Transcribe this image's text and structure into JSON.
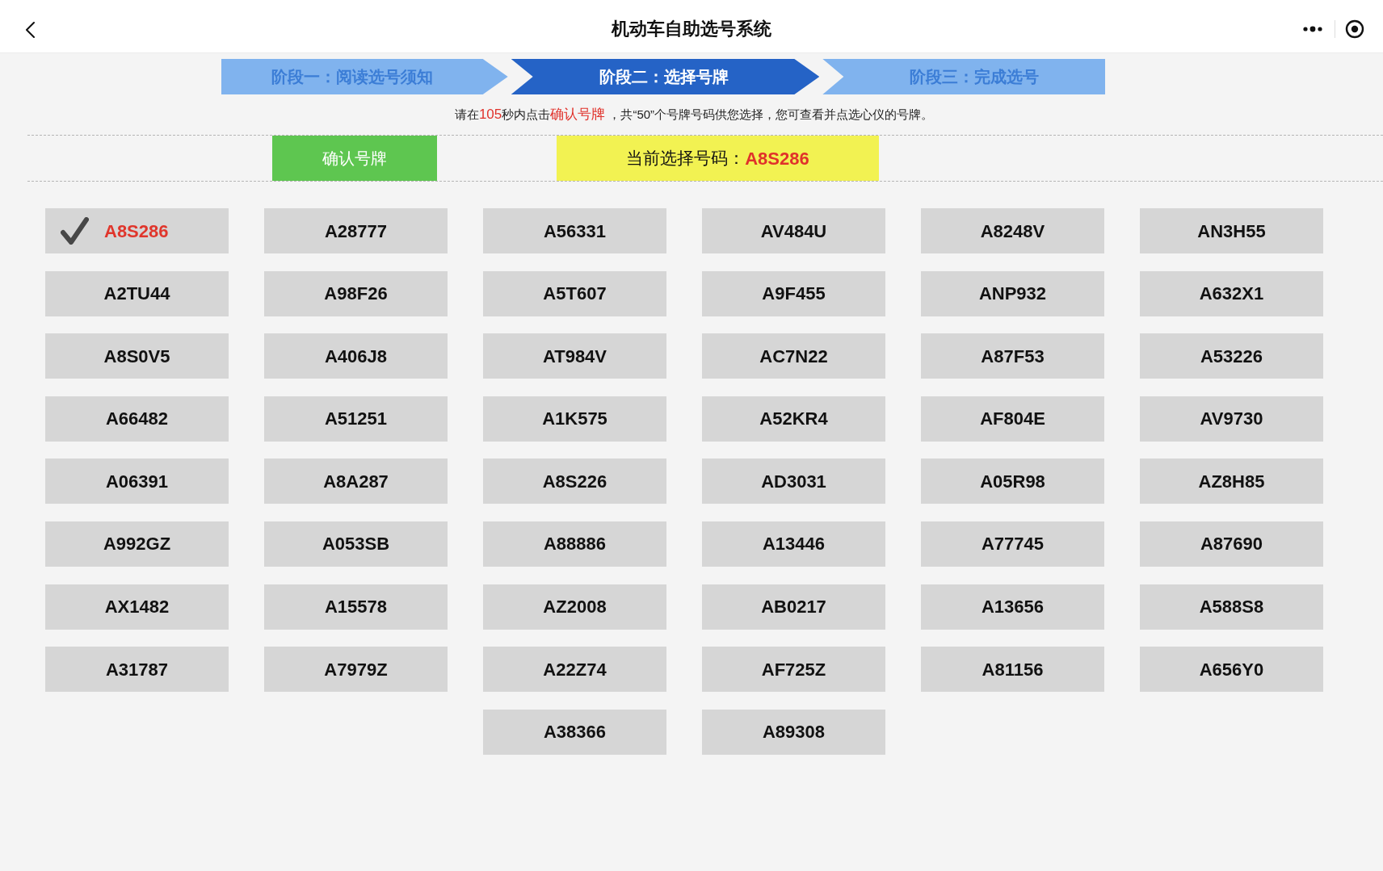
{
  "header": {
    "title": "机动车自助选号系统"
  },
  "steps": [
    {
      "label": "阶段一：阅读选号须知",
      "selected": false
    },
    {
      "label": "阶段二：选择号牌",
      "selected": true
    },
    {
      "label": "阶段三：完成选号",
      "selected": false
    }
  ],
  "notice": [
    {
      "text": "请在",
      "highlight": false
    },
    {
      "text": "105",
      "highlight": true
    },
    {
      "text": "秒内点击",
      "highlight": false
    },
    {
      "text": "确认号牌",
      "highlight": true
    },
    {
      "text": " ，共“50”个号牌号码供您选择，您可查看并点选心仪的号牌。",
      "highlight": false
    }
  ],
  "confirm_button": {
    "label": "确认号牌"
  },
  "current_selection": {
    "label": "当前选择号码：",
    "value": "A8S286"
  },
  "plates": [
    {
      "number": "A8S286",
      "selected": true
    },
    {
      "number": "A28777",
      "selected": false
    },
    {
      "number": "A56331",
      "selected": false
    },
    {
      "number": "AV484U",
      "selected": false
    },
    {
      "number": "A8248V",
      "selected": false
    },
    {
      "number": "AN3H55",
      "selected": false
    },
    {
      "number": "A2TU44",
      "selected": false
    },
    {
      "number": "A98F26",
      "selected": false
    },
    {
      "number": "A5T607",
      "selected": false
    },
    {
      "number": "A9F455",
      "selected": false
    },
    {
      "number": "ANP932",
      "selected": false
    },
    {
      "number": "A632X1",
      "selected": false
    },
    {
      "number": "A8S0V5",
      "selected": false
    },
    {
      "number": "A406J8",
      "selected": false
    },
    {
      "number": "AT984V",
      "selected": false
    },
    {
      "number": "AC7N22",
      "selected": false
    },
    {
      "number": "A87F53",
      "selected": false
    },
    {
      "number": "A53226",
      "selected": false
    },
    {
      "number": "A66482",
      "selected": false
    },
    {
      "number": "A51251",
      "selected": false
    },
    {
      "number": "A1K575",
      "selected": false
    },
    {
      "number": "A52KR4",
      "selected": false
    },
    {
      "number": "AF804E",
      "selected": false
    },
    {
      "number": "AV9730",
      "selected": false
    },
    {
      "number": "A06391",
      "selected": false
    },
    {
      "number": "A8A287",
      "selected": false
    },
    {
      "number": "A8S226",
      "selected": false
    },
    {
      "number": "AD3031",
      "selected": false
    },
    {
      "number": "A05R98",
      "selected": false
    },
    {
      "number": "AZ8H85",
      "selected": false
    },
    {
      "number": "A992GZ",
      "selected": false
    },
    {
      "number": "A053SB",
      "selected": false
    },
    {
      "number": "A88886",
      "selected": false
    },
    {
      "number": "A13446",
      "selected": false
    },
    {
      "number": "A77745",
      "selected": false
    },
    {
      "number": "A87690",
      "selected": false
    },
    {
      "number": "AX1482",
      "selected": false
    },
    {
      "number": "A15578",
      "selected": false
    },
    {
      "number": "AZ2008",
      "selected": false
    },
    {
      "number": "AB0217",
      "selected": false
    },
    {
      "number": "A13656",
      "selected": false
    },
    {
      "number": "A588S8",
      "selected": false
    },
    {
      "number": "A31787",
      "selected": false
    },
    {
      "number": "A7979Z",
      "selected": false
    },
    {
      "number": "A22Z74",
      "selected": false
    },
    {
      "number": "AF725Z",
      "selected": false
    },
    {
      "number": "A81156",
      "selected": false
    },
    {
      "number": "A656Y0",
      "selected": false
    },
    {
      "number": "A38366",
      "selected": false
    },
    {
      "number": "A89308",
      "selected": false
    }
  ]
}
